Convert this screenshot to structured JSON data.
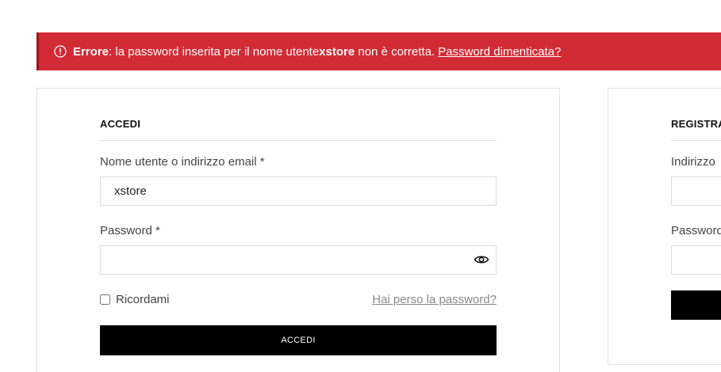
{
  "error": {
    "label_strong": "Errore",
    "message_part1": ": la password inserita per il nome utente ",
    "username": "xstore",
    "message_part2": " non è corretta. ",
    "link": "Password dimenticata?"
  },
  "login": {
    "title": "ACCEDI",
    "username_label": "Nome utente o indirizzo email *",
    "username_value": "xstore",
    "password_label": "Password *",
    "password_value": "",
    "remember_label": "Ricordami",
    "lost_password": "Hai perso la password?",
    "submit_label": "ACCEDI"
  },
  "register": {
    "title": "REGISTRA",
    "email_label": "Indirizzo",
    "password_label": "Password"
  },
  "colors": {
    "error_bg": "#d22b35",
    "button_bg": "#000000"
  }
}
